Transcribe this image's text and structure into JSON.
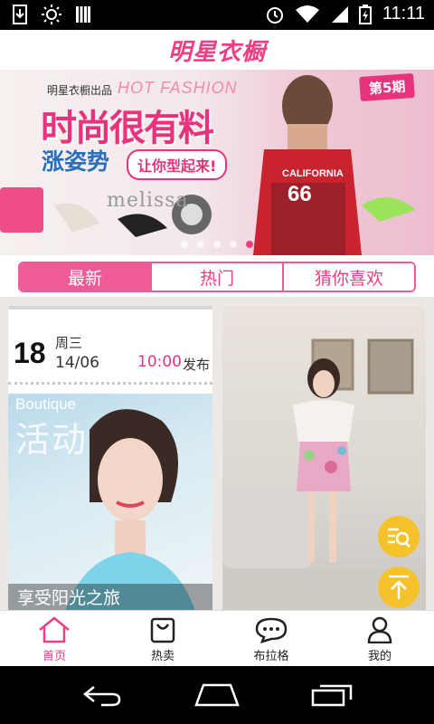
{
  "status_bar": {
    "time": "11:11",
    "icons_left": [
      "download-icon",
      "brightness-icon",
      "signal-bars-icon"
    ],
    "icons_right": [
      "alarm-icon",
      "wifi-icon",
      "cellular-icon",
      "battery-icon"
    ]
  },
  "header": {
    "title": "明星衣橱"
  },
  "banner": {
    "brand_small": "明星衣橱出品",
    "hot_fashion": "HOT FASHION",
    "main_slogan": "时尚很有料",
    "sub_slogan": "涨姿势",
    "tag_slogan": "让你型起来!",
    "issue": "第5期",
    "melissa": "melissa",
    "carousel_pages": 5,
    "carousel_active_index": 4
  },
  "tabs": {
    "items": [
      {
        "label": "最新",
        "active": true
      },
      {
        "label": "热门",
        "active": false
      },
      {
        "label": "猜你喜欢",
        "active": false
      }
    ]
  },
  "feed": {
    "date": {
      "day": "18",
      "weekday": "周三",
      "month_day": "14/06"
    },
    "release_time": "10:00",
    "release_label": "发布",
    "promo": {
      "en_title": "Boutique",
      "cn_title": "活动",
      "caption": "享受阳光之旅"
    }
  },
  "bottom_nav": {
    "items": [
      {
        "label": "首页",
        "icon": "home-icon",
        "active": true
      },
      {
        "label": "热卖",
        "icon": "shopping-bag-icon",
        "active": false
      },
      {
        "label": "布拉格",
        "icon": "chat-bubble-icon",
        "active": false
      },
      {
        "label": "我的",
        "icon": "user-icon",
        "active": false
      }
    ]
  },
  "colors": {
    "accent": "#ef3f82",
    "fab": "#f6c22b"
  }
}
